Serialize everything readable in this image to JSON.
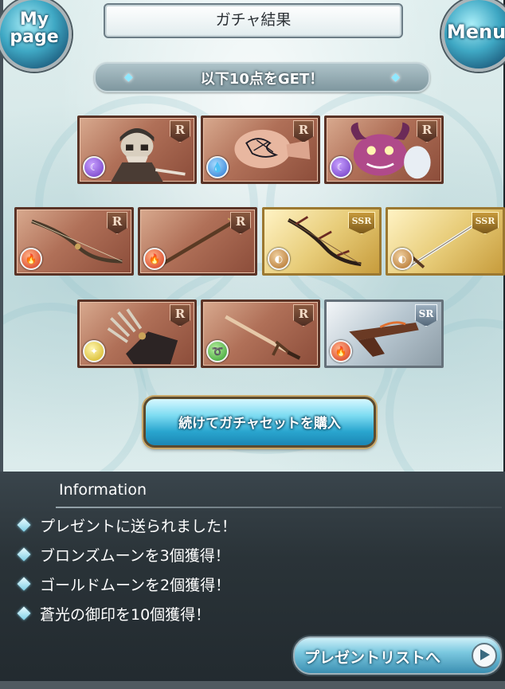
{
  "header": {
    "title": "ガチャ結果",
    "mypage_label_line1": "My",
    "mypage_label_line2": "page",
    "menu_label": "Menu"
  },
  "banner": {
    "text": "以下10点をGET！"
  },
  "cards": [
    {
      "rarity": "R",
      "element": "dark",
      "element_icon": "dark-element-icon",
      "subject": "armored-skeleton"
    },
    {
      "rarity": "R",
      "element": "water",
      "element_icon": "water-element-icon",
      "subject": "tattooed-fist"
    },
    {
      "rarity": "R",
      "element": "dark",
      "element_icon": "dark-element-icon",
      "subject": "purple-horned-demon"
    },
    {
      "rarity": "R",
      "element": "fire",
      "element_icon": "fire-element-icon",
      "subject": "bow"
    },
    {
      "rarity": "R",
      "element": "fire",
      "element_icon": "fire-element-icon",
      "subject": "staff"
    },
    {
      "rarity": "SSR",
      "element": "earth",
      "element_icon": "earth-element-icon",
      "subject": "dark-bow"
    },
    {
      "rarity": "SSR",
      "element": "earth",
      "element_icon": "earth-element-icon",
      "subject": "long-sword"
    },
    {
      "rarity": "R",
      "element": "light",
      "element_icon": "light-element-icon",
      "subject": "clawed-gauntlet"
    },
    {
      "rarity": "R",
      "element": "wind",
      "element_icon": "wind-element-icon",
      "subject": "sword"
    },
    {
      "rarity": "SR",
      "element": "fire",
      "element_icon": "fire-element-icon",
      "subject": "gun"
    }
  ],
  "action": {
    "label": "続けてガチャセットを購入"
  },
  "information": {
    "title": "Information",
    "items": [
      "プレゼントに送られました！",
      "ブロンズムーンを3個獲得！",
      "ゴールドムーンを2個獲得！",
      "蒼光の御印を10個獲得！"
    ],
    "present_button": "プレゼントリストへ"
  },
  "colors": {
    "accent": "#2aa6cf",
    "panel_dark": "#2a3338",
    "card_r": "#b07058",
    "card_ssr": "#e8cd7a",
    "card_sr": "#b7c6d0"
  }
}
